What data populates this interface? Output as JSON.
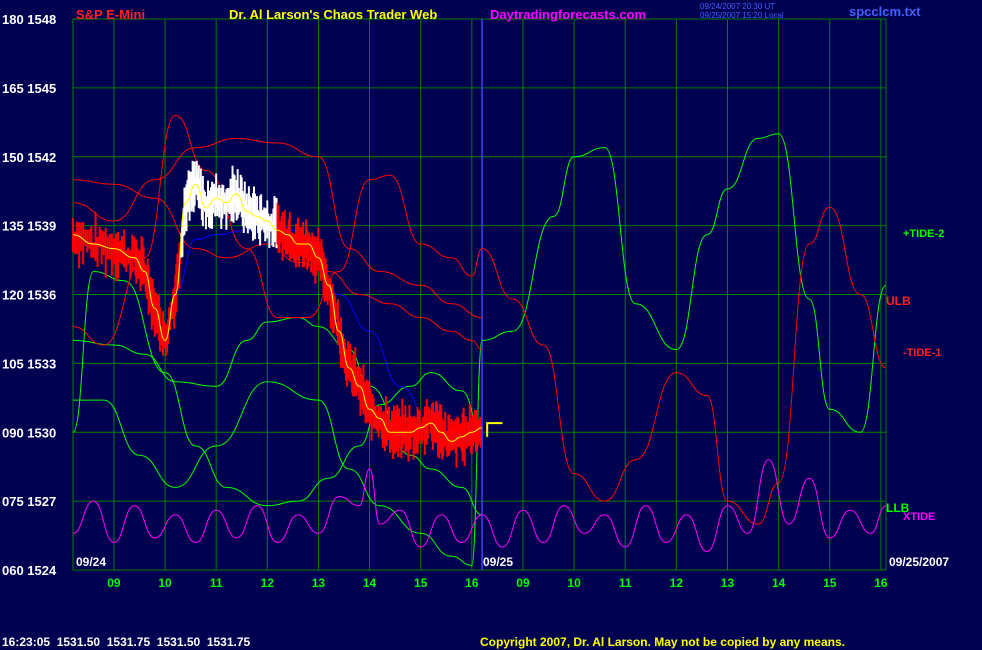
{
  "header": {
    "instrument": "S&P E-Mini",
    "site_title": "Dr. Al Larson's Chaos Trader Web",
    "site_url": "Daytradingforecasts.com",
    "stamp_line1": "09/24/2007 20:30 UT",
    "stamp_line2": "09/25/2007 15:20 Local",
    "file_name": "spcclcm.txt"
  },
  "footer": {
    "quote": "16:23:05  1531.50  1531.75  1531.50  1531.75",
    "copyright": "Copyright 2007, Dr. Al Larson. May not be copied by any means."
  },
  "colors": {
    "background": "#000050",
    "grid": "#008000",
    "price_bar": "#ff0000",
    "price_bar_highlight": "#ffffff",
    "tide_plus": "#00ff00",
    "tide_minus": "#ff0000",
    "xtide": "#ff00ff",
    "moving_avg": "#0000ff",
    "smooth_price": "#ffff00",
    "divider": "#4040ff"
  },
  "chart_data": {
    "type": "line",
    "y_axis": {
      "labels": [
        {
          "scale": "180",
          "price": "1548"
        },
        {
          "scale": "165",
          "price": "1545"
        },
        {
          "scale": "150",
          "price": "1542"
        },
        {
          "scale": "135",
          "price": "1539"
        },
        {
          "scale": "120",
          "price": "1536"
        },
        {
          "scale": "105",
          "price": "1533"
        },
        {
          "scale": "090",
          "price": "1530"
        },
        {
          "scale": "075",
          "price": "1527"
        },
        {
          "scale": "060",
          "price": "1524"
        }
      ],
      "scale_range": [
        60,
        180
      ],
      "price_range": [
        1524,
        1548
      ]
    },
    "x_axis": {
      "day1_label": "09/24",
      "day2_label": "09/25",
      "end_label": "09/25/2007",
      "ticks": [
        "09",
        "10",
        "11",
        "12",
        "13",
        "14",
        "15",
        "16",
        "09",
        "10",
        "11",
        "12",
        "13",
        "14",
        "15",
        "16"
      ],
      "range_hours": [
        8.2,
        24.1
      ]
    },
    "legend": {
      "tide_plus": "+TIDE-2",
      "ulb": "ULB",
      "tide_minus": "-TIDE-1",
      "llb": "LLB",
      "xtide": "XTIDE"
    },
    "series": [
      {
        "name": "+TIDE-2",
        "x": [
          8.2,
          8.8,
          9.5,
          10.2,
          11.0,
          12.0,
          13.0,
          13.6,
          14.2,
          15.0,
          15.6,
          16.0,
          16.2,
          16.8,
          17.6,
          18.0,
          18.6,
          19.2,
          20.0,
          20.6,
          21.0,
          21.6,
          22.0,
          22.6,
          23.0,
          23.6,
          24.1
        ],
        "y": [
          97,
          97,
          85,
          78,
          87,
          101,
          97,
          82,
          74,
          68,
          63,
          61,
          110,
          112,
          137,
          150,
          152,
          118,
          108,
          133,
          143,
          154,
          155,
          119,
          95,
          90,
          122
        ]
      },
      {
        "name": "+TIDE-2b",
        "x": [
          8.2,
          8.6,
          9.2,
          10.0,
          10.6,
          11.2,
          12.0,
          12.6,
          13.2,
          13.8,
          14.2,
          14.8,
          15.2,
          15.8,
          16.2
        ],
        "y": [
          90,
          125,
          123,
          103,
          87,
          78,
          74,
          75,
          80,
          87,
          96,
          100,
          103,
          99,
          90
        ]
      },
      {
        "name": "+TIDE-2c",
        "x": [
          8.2,
          9.0,
          9.6,
          10.2,
          11.0,
          11.6,
          12.0,
          12.6,
          13.0,
          13.6,
          14.0,
          14.8,
          15.2,
          15.8,
          16.2
        ],
        "y": [
          110,
          109,
          107,
          101,
          100,
          110,
          114,
          115,
          113,
          108,
          100,
          85,
          82,
          78,
          72
        ]
      },
      {
        "name": "ULB",
        "x": [
          8.2,
          9.0,
          9.8,
          10.6,
          11.2,
          12.0,
          12.6,
          13.2,
          13.8,
          14.4,
          15.0,
          15.6,
          16.0,
          16.2
        ],
        "y": [
          145,
          144,
          141,
          130,
          128,
          131,
          127,
          125,
          120,
          118,
          115,
          112,
          110,
          108
        ]
      },
      {
        "name": "-TIDE-1",
        "x": [
          8.2,
          8.8,
          9.6,
          10.2,
          10.8,
          11.6,
          12.2,
          12.8,
          13.4,
          14.0,
          14.4,
          15.0,
          15.6,
          16.0,
          16.2,
          16.8,
          17.4,
          18.0,
          18.6,
          19.2,
          20.0,
          20.6,
          21.0,
          21.6,
          22.0,
          22.6,
          23.0,
          23.6,
          24.1
        ],
        "y": [
          113,
          109,
          128,
          159,
          147,
          130,
          115,
          115,
          125,
          145,
          146,
          131,
          128,
          124,
          130,
          119,
          109,
          81,
          75,
          84,
          103,
          98,
          75,
          70,
          79,
          131,
          139,
          120,
          104
        ]
      },
      {
        "name": "LLB",
        "x": [
          8.2,
          9.0,
          9.8,
          10.6,
          11.4,
          12.2,
          13.0,
          13.6,
          14.2,
          15.0,
          15.6,
          16.2
        ],
        "y": [
          140,
          136,
          145,
          152,
          154,
          153,
          150,
          130,
          125,
          122,
          118,
          115
        ]
      },
      {
        "name": "XTIDE",
        "x": [
          8.2,
          8.6,
          9.0,
          9.4,
          9.8,
          10.2,
          10.6,
          11.0,
          11.4,
          11.8,
          12.2,
          12.6,
          13.0,
          13.4,
          13.8,
          14.0,
          14.2,
          14.6,
          15.0,
          15.4,
          15.8,
          16.2,
          16.6,
          17.0,
          17.4,
          17.8,
          18.2,
          18.6,
          19.0,
          19.4,
          19.8,
          20.2,
          20.6,
          21.0,
          21.4,
          21.8,
          22.2,
          22.6,
          23.0,
          23.4,
          23.8,
          24.1
        ],
        "y": [
          68,
          75,
          66,
          74,
          67,
          72,
          66,
          73,
          67,
          74,
          66,
          72,
          68,
          76,
          74,
          82,
          70,
          73,
          65,
          72,
          66,
          72,
          65,
          73,
          66,
          74,
          68,
          72,
          65,
          74,
          66,
          72,
          64,
          74,
          68,
          84,
          70,
          80,
          67,
          73,
          68,
          74
        ]
      },
      {
        "name": "price",
        "x": [
          8.2,
          8.6,
          9.0,
          9.4,
          9.6,
          9.8,
          10.0,
          10.2,
          10.4,
          10.6,
          10.8,
          11.0,
          11.2,
          11.4,
          11.6,
          11.8,
          12.0,
          12.2,
          12.4,
          12.6,
          12.8,
          13.0,
          13.2,
          13.4,
          13.6,
          13.8,
          14.0,
          14.2,
          14.4,
          14.6,
          14.8,
          15.0,
          15.2,
          15.4,
          15.6,
          15.8,
          16.0,
          16.2
        ],
        "y": [
          133,
          131,
          130,
          128,
          125,
          117,
          110,
          120,
          140,
          144,
          139,
          141,
          140,
          142,
          138,
          137,
          136,
          134,
          133,
          131,
          131,
          128,
          122,
          112,
          104,
          100,
          95,
          93,
          90,
          90,
          90,
          91,
          92,
          90,
          88,
          89,
          90,
          91
        ]
      },
      {
        "name": "moving-avg",
        "x": [
          10.2,
          10.6,
          11.0,
          11.6,
          12.2,
          12.8,
          13.4,
          14.0,
          14.6,
          15.2,
          15.8,
          16.2
        ],
        "y": [
          120,
          132,
          133,
          134,
          135,
          133,
          120,
          112,
          100,
          92,
          88,
          90
        ]
      }
    ]
  }
}
